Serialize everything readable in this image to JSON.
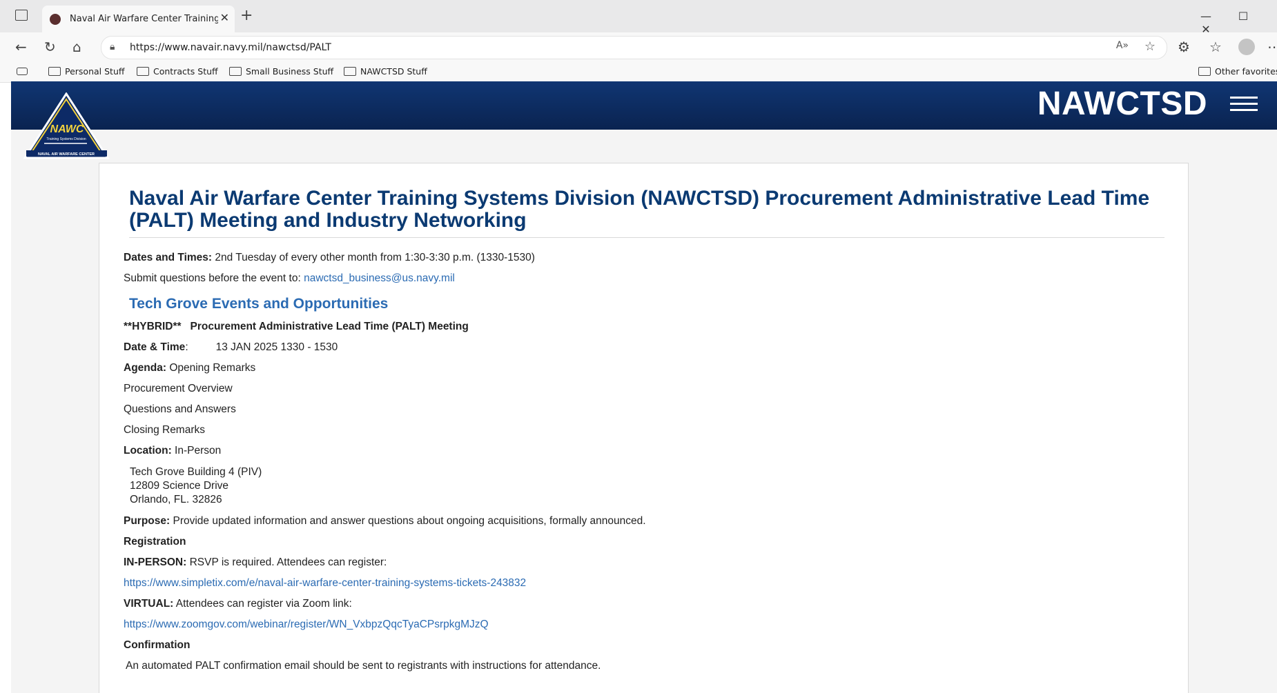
{
  "browser": {
    "tab_title": "Naval Air Warfare Center Training",
    "url": "https://www.navair.navy.mil/nawctsd/PALT",
    "read_aloud": "A»",
    "bookmarks": [
      "Personal Stuff",
      "Contracts Stuff",
      "Small Business Stuff",
      "NAWCTSD Stuff"
    ],
    "other_favorites": "Other favorites"
  },
  "header": {
    "site_title": "NAWCTSD",
    "logo_text": "NAWC",
    "logo_subtext": "Training Systems Division",
    "logo_footer": "NAVAL AIR WARFARE CENTER"
  },
  "main": {
    "title": "Naval Air Warfare Center Training Systems Division (NAWCTSD) Procurement Administrative Lead Time (PALT) Meeting and Industry Networking",
    "dates_label": "Dates and Times:",
    "dates_value": " 2nd Tuesday of every other month from 1:30-3:30 p.m. (1330-1530)",
    "submit_text": "Submit questions before the event to: ",
    "submit_email": "nawctsd_business@us.navy.mil",
    "events_heading": "Tech Grove Events and Opportunities",
    "event_hybrid": "**HYBRID**",
    "event_name": "Procurement Administrative Lead Time (PALT) Meeting",
    "datetime_label": "Date & Time",
    "datetime_value": "13 JAN 2025 1330 - 1530",
    "agenda_label": "Agenda:",
    "agenda_items": [
      "Opening Remarks",
      "Procurement Overview",
      "Questions and Answers",
      "Closing Remarks"
    ],
    "location_label": "Location:",
    "location_value": " In-Person",
    "address": [
      "Tech Grove Building 4 (PIV)",
      "12809 Science Drive",
      "Orlando, FL. 32826"
    ],
    "purpose_label": "Purpose:",
    "purpose_value": " Provide updated information and answer questions about ongoing acquisitions, formally announced.",
    "registration_heading": "Registration",
    "inperson_label": "IN-PERSON:",
    "inperson_value": " RSVP is required. Attendees can register:",
    "inperson_link": "https://www.simpletix.com/e/naval-air-warfare-center-training-systems-tickets-243832",
    "virtual_label": "VIRTUAL:",
    "virtual_value": " Attendees can register via Zoom link:",
    "virtual_link": "https://www.zoomgov.com/webinar/register/WN_VxbpzQqcTyaCPsrpkgMJzQ",
    "confirmation_heading": "Confirmation",
    "confirmation_text": "An automated PALT confirmation email should be sent to registrants with instructions for attendance."
  },
  "colors": {
    "banner": "#0a2350",
    "heading": "#0b3a72",
    "link": "#2b6bb3"
  }
}
